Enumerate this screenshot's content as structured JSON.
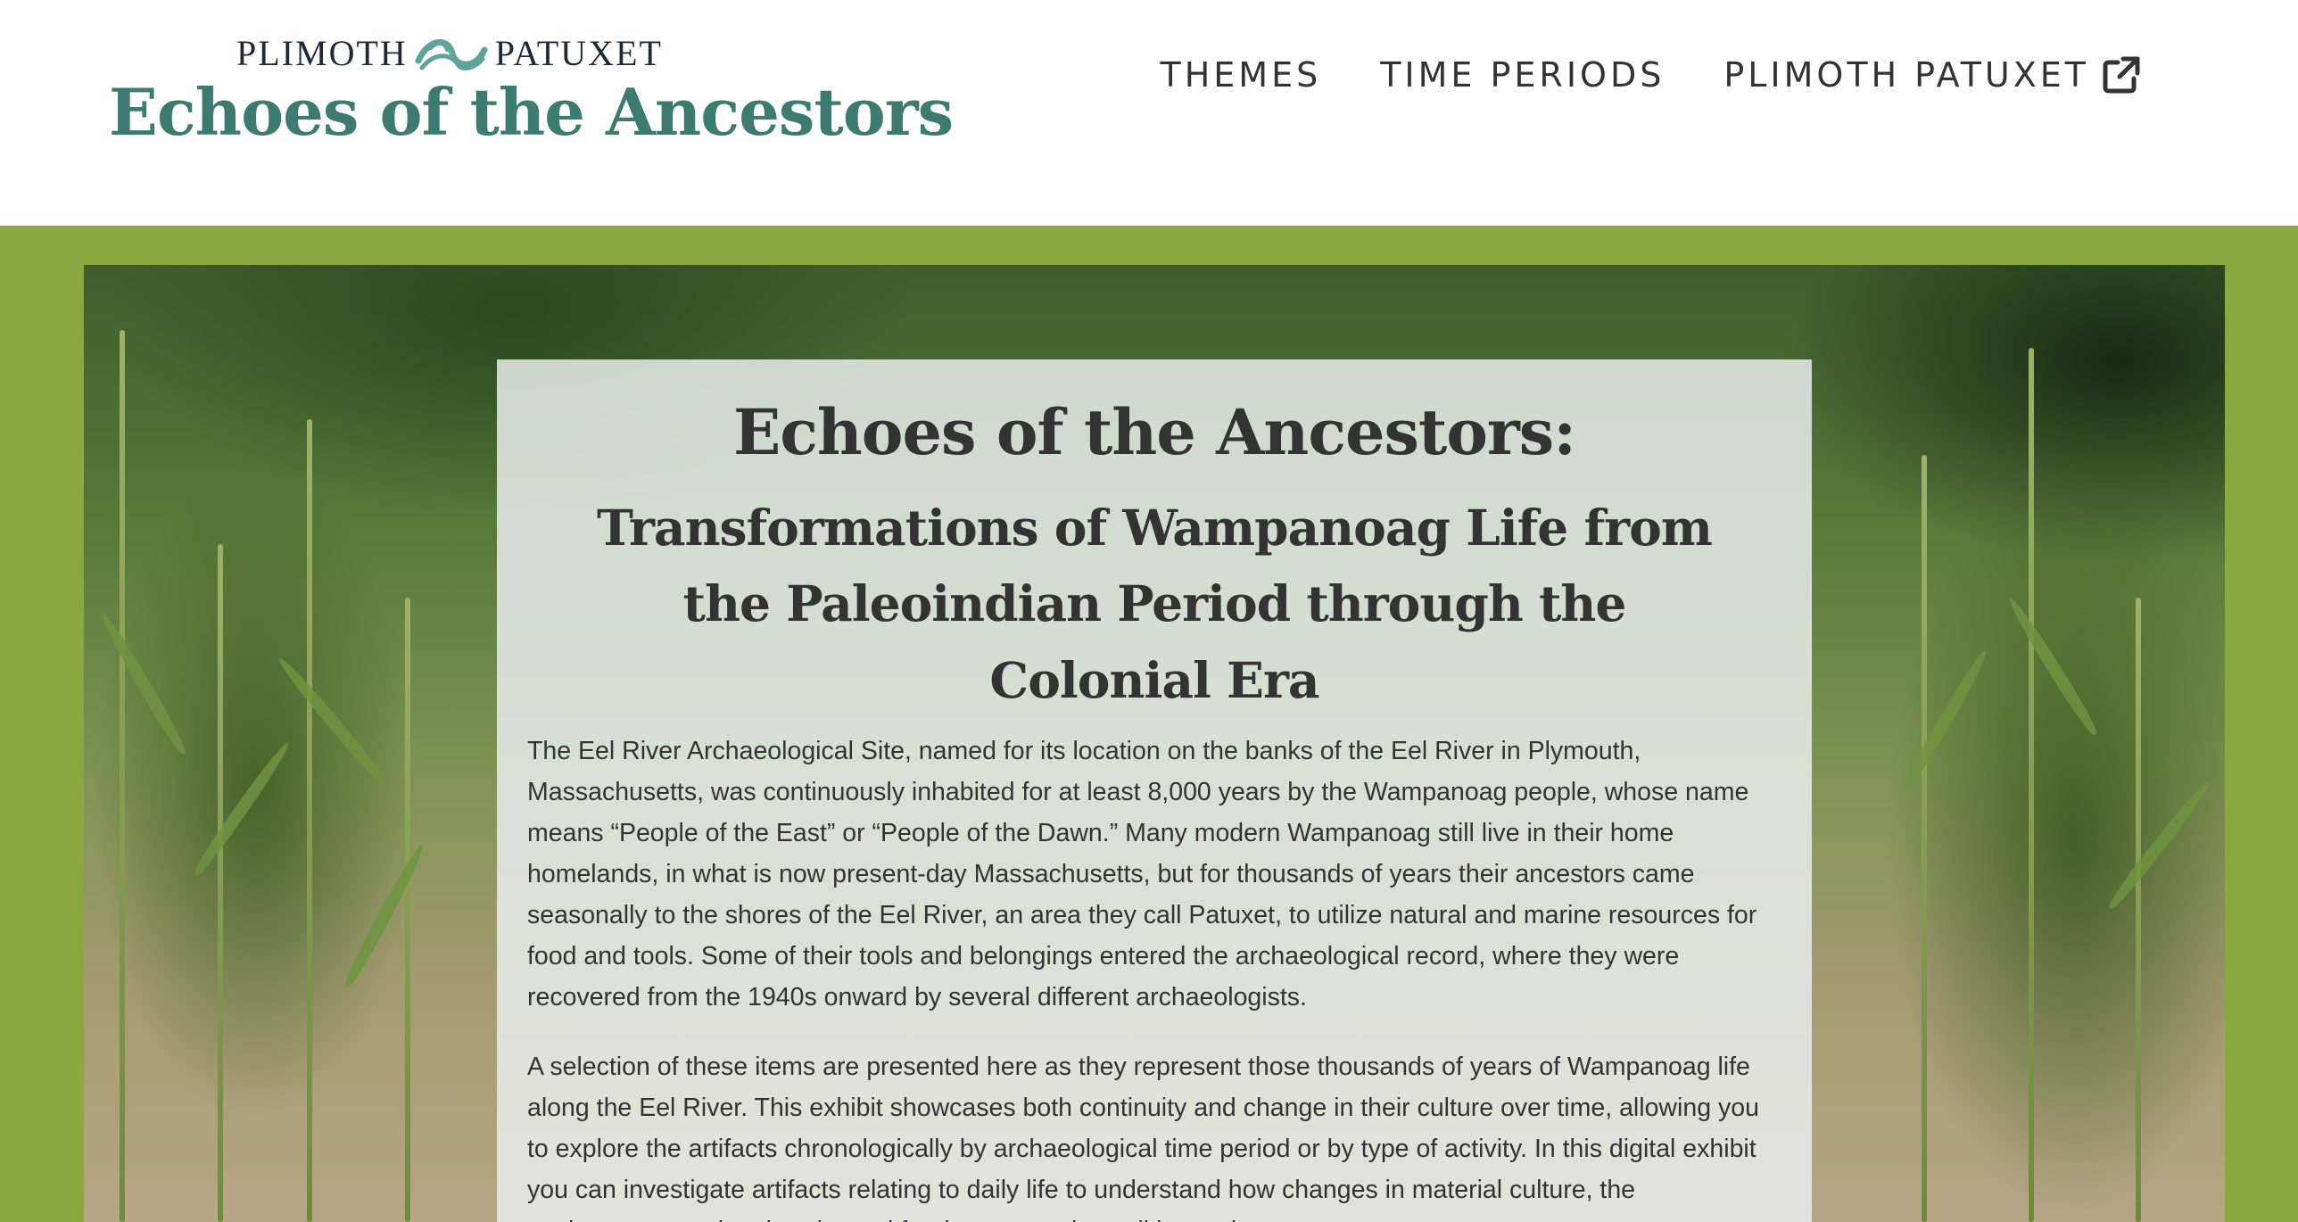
{
  "header": {
    "org_name_left": "PLIMOTH",
    "org_name_right": "PATUXET",
    "site_title": "Echoes of the Ancestors",
    "logo_icon": "swirl-logo-icon"
  },
  "nav": {
    "items": [
      {
        "label": "THEMES"
      },
      {
        "label": "TIME PERIODS"
      },
      {
        "label": "PLIMOTH PATUXET",
        "icon": "external-link-icon"
      }
    ]
  },
  "hero": {
    "title": "Echoes of the Ancestors:",
    "subtitle": "Transformations of Wampanoag Life from the Paleoindian Period through the Colonial Era",
    "paragraphs": [
      "The Eel River Archaeological Site, named for its location on the banks of the Eel River in Plymouth, Massachusetts, was continuously inhabited for at least 8,000 years by the Wampanoag people, whose name means “People of the East” or “People of the Dawn.” Many modern Wampanoag still live in their home homelands, in what is now present-day Massachusetts, but for thousands of years their ancestors came seasonally to the shores of the Eel River, an area they call Patuxet, to utilize natural and marine resources for food and tools. Some of their tools and belongings entered the archaeological record, where they were recovered from the 1940s onward by several different archaeologists.",
      "A selection of these items are presented here as they represent those thousands of years of Wampanoag life along the Eel River. This exhibit showcases both continuity and change in their culture over time, allowing you to explore the artifacts chronologically by archaeological time period or by type of activity. In this digital exhibit you can investigate artifacts relating to daily life to understand how changes in material culture, the environment, regional trade, and foodways practices all intertwine."
    ]
  },
  "colors": {
    "brand_teal": "#3d7a70",
    "hero_band_green": "#8aa740",
    "text_dark": "#333333",
    "org_navy": "#1c2a3a"
  }
}
